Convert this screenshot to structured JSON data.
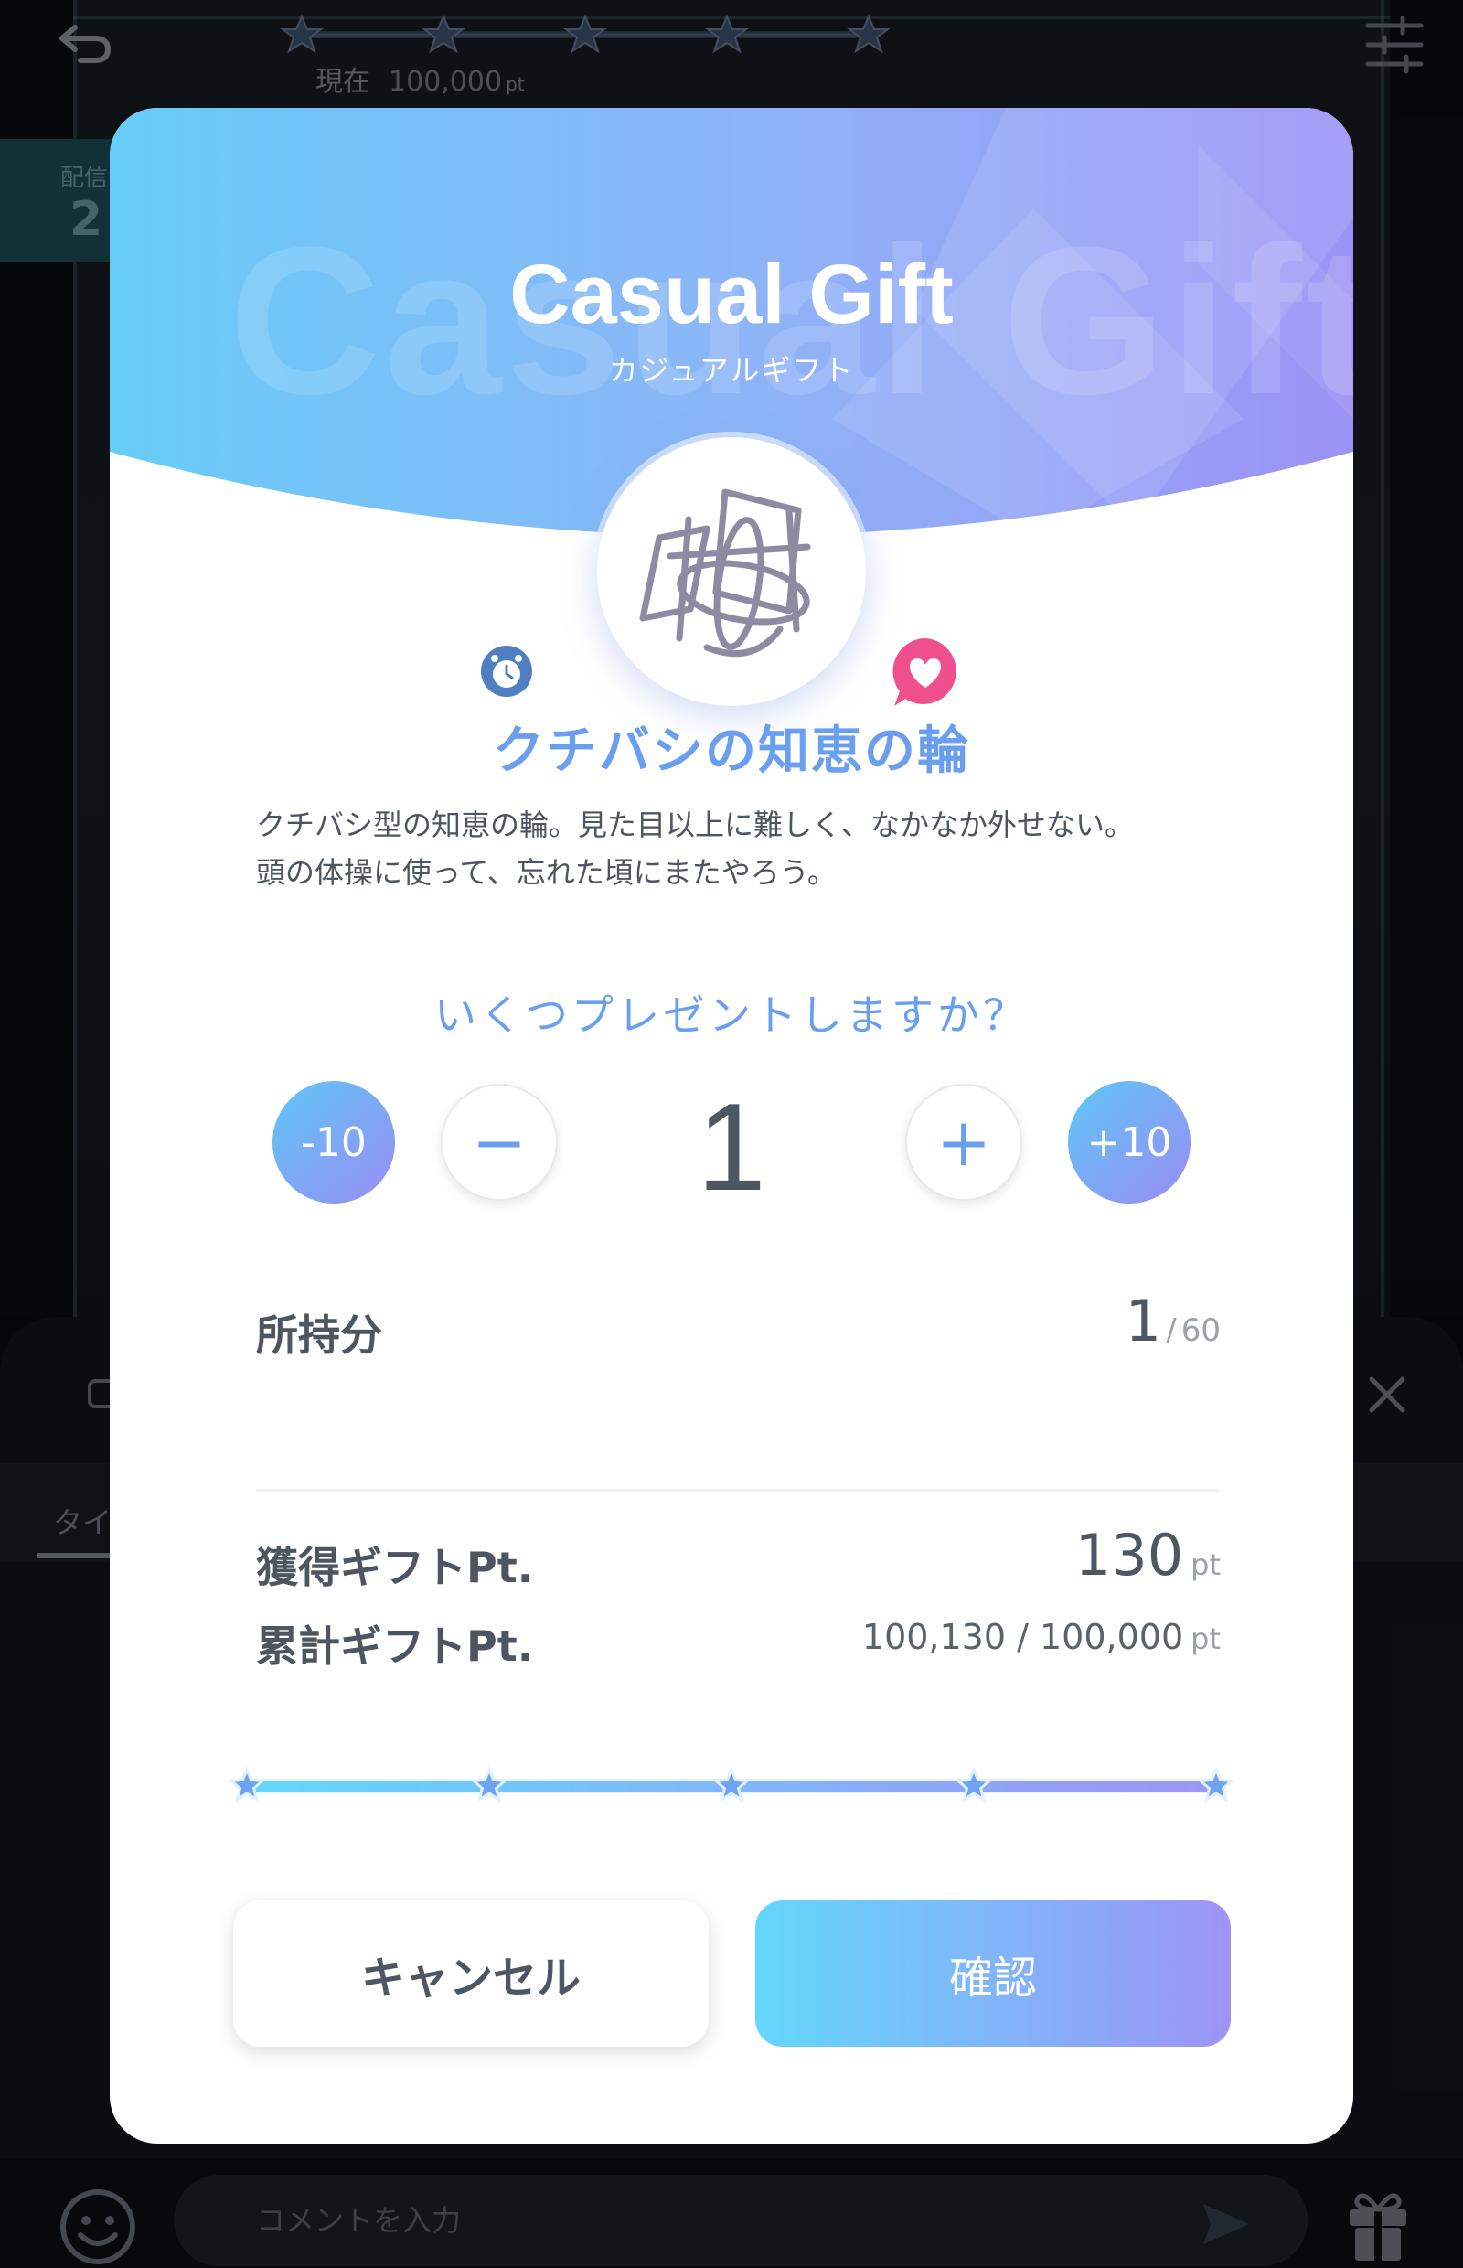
{
  "background": {
    "top_progress": {
      "current_label": "現在",
      "current_value": "100,000",
      "unit": "pt"
    },
    "left_tab": {
      "label": "配信",
      "value": "2"
    },
    "sheet": {
      "tab_label": "タイ"
    },
    "comment": {
      "placeholder": "コメントを入力"
    }
  },
  "modal": {
    "ghost_title": "Casual Gift",
    "title": "Casual Gift",
    "subtitle": "カジュアルギフト",
    "item_name": "クチバシの知恵の輪",
    "description_line1": "クチバシ型の知恵の輪。見た目以上に難しく、なかなか外せない。",
    "description_line2": "頭の体操に使って、忘れた頃にまたやろう。",
    "question": "いくつプレゼントしますか？",
    "quantity": {
      "minus10_label": "-10",
      "minus_label": "−",
      "value": "1",
      "plus_label": "+",
      "plus10_label": "+10"
    },
    "owned": {
      "label": "所持分",
      "value": "1",
      "separator": "/",
      "max": "60"
    },
    "earned": {
      "label": "獲得ギフトPt.",
      "value": "130",
      "unit": "pt"
    },
    "total": {
      "label": "累計ギフトPt.",
      "value": "100,130 / 100,000",
      "unit": "pt"
    },
    "progress": {
      "steps": 5,
      "filled_fraction": 1.0
    },
    "buttons": {
      "cancel": "キャンセル",
      "confirm": "確認"
    }
  },
  "colors": {
    "accent": "#6a9ff0",
    "gradient_start": "#5ec7f6",
    "gradient_end": "#9a8cf4",
    "heart": "#ef4f8c"
  }
}
